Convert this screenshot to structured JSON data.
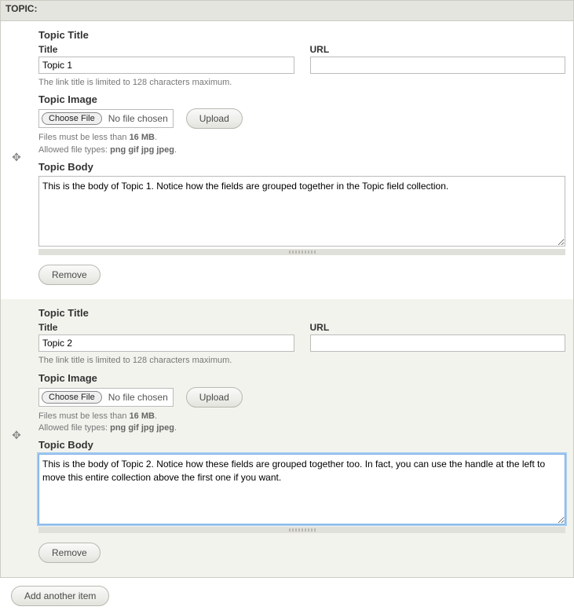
{
  "section": {
    "label": "TOPIC:"
  },
  "labels": {
    "topic_title_group": "Topic Title",
    "title": "Title",
    "url": "URL",
    "title_hint": "The link title is limited to 128 characters maximum.",
    "topic_image_group": "Topic Image",
    "choose_file": "Choose File",
    "no_file": "No file chosen",
    "upload": "Upload",
    "file_hint_size_pre": "Files must be less than ",
    "file_hint_size_val": "16 MB",
    "file_hint_types_pre": "Allowed file types: ",
    "file_hint_types_val": "png gif jpg jpeg",
    "topic_body_group": "Topic Body",
    "remove": "Remove",
    "add_item": "Add another item"
  },
  "topics": [
    {
      "title": "Topic 1",
      "url": "",
      "body": "This is the body of Topic 1. Notice how the fields are grouped together in the Topic field collection.",
      "focused": false
    },
    {
      "title": "Topic 2",
      "url": "",
      "body": "This is the body of Topic 2. Notice how these fields are grouped together too. In fact, you can use the handle at the left to move this entire collection above the first one if you want.",
      "focused": true
    }
  ]
}
